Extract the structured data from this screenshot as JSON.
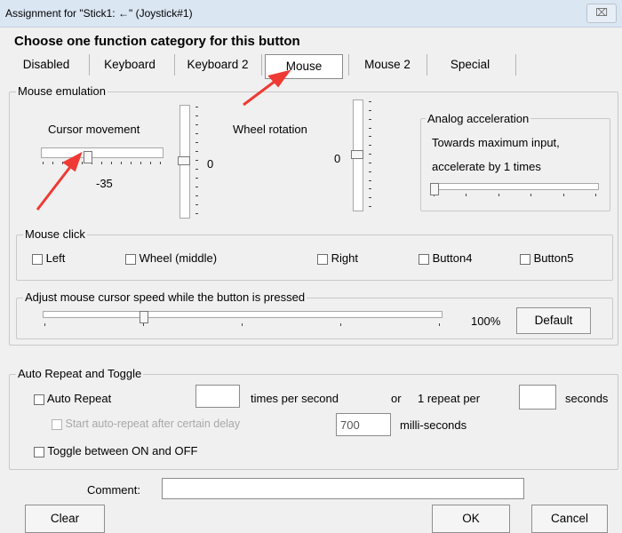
{
  "window": {
    "title": "Assignment for \"Stick1: ←\" (Joystick#1)",
    "close_label": "⌧"
  },
  "heading": "Choose one function category for this button",
  "tabs": [
    {
      "label": "Disabled"
    },
    {
      "label": "Keyboard"
    },
    {
      "label": "Keyboard 2"
    },
    {
      "label": "Mouse",
      "active": true
    },
    {
      "label": "Mouse 2"
    },
    {
      "label": "Special"
    }
  ],
  "mouse_emulation": {
    "label": "Mouse emulation",
    "cursor_movement": {
      "label": "Cursor movement",
      "horizontal_value": "-35",
      "vertical_value": "0",
      "horizontal_level": 0.375,
      "vertical_level": 0.5
    },
    "wheel_rotation": {
      "label": "Wheel rotation",
      "value": "0",
      "level": 0.5
    },
    "analog": {
      "label": "Analog acceleration",
      "line1": "Towards maximum input,",
      "line2": "accelerate by 1 times",
      "level": 0.0
    }
  },
  "mouse_click": {
    "label": "Mouse click",
    "items": [
      {
        "label": "Left"
      },
      {
        "label": "Wheel (middle)"
      },
      {
        "label": "Right"
      },
      {
        "label": "Button4"
      },
      {
        "label": "Button5"
      }
    ]
  },
  "speed": {
    "label": "Adjust mouse cursor speed while the button is pressed",
    "value": "100%",
    "default_label": "Default",
    "level": 0.25
  },
  "auto_repeat": {
    "label": "Auto Repeat and Toggle",
    "auto_repeat_label": "Auto Repeat",
    "times_value": "",
    "times_label": "times per second",
    "or_label": "or",
    "one_repeat_label": "1 repeat per",
    "seconds_value": "",
    "seconds_label": "seconds",
    "delay_label": "Start auto-repeat after certain delay",
    "delay_value": "700",
    "ms_label": "milli-seconds",
    "toggle_label": "Toggle between ON and OFF"
  },
  "comment": {
    "label": "Comment:",
    "value": ""
  },
  "buttons": {
    "clear": "Clear",
    "ok": "OK",
    "cancel": "Cancel"
  },
  "colors": {
    "annotation_arrow": "#ef3a33",
    "title_bar": "#dbe6f3"
  }
}
